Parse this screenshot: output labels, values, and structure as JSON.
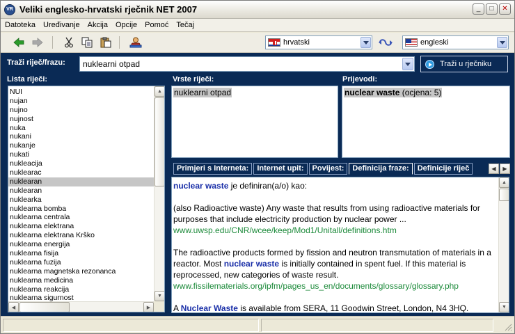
{
  "window": {
    "title": "Veliki englesko-hrvatski rječnik NET 2007",
    "app_icon_text": "VR",
    "controls": {
      "minimize": "_",
      "maximize": "□",
      "close": "✕"
    }
  },
  "menu": [
    "Datoteka",
    "Uređivanje",
    "Akcija",
    "Opcije",
    "Pomoć",
    "Tečaj"
  ],
  "toolbar": {
    "source_language": "hrvatski",
    "target_language": "engleski",
    "icons": [
      "back-arrow-icon",
      "forward-arrow-icon",
      "cut-icon",
      "copy-icon",
      "paste-icon",
      "user-icon",
      "swap-languages-icon"
    ]
  },
  "search": {
    "label": "Traži riječ/frazu:",
    "value": "nuklearni otpad",
    "button": "Traži u rječniku"
  },
  "word_list": {
    "label": "Lista riječi:",
    "items": [
      "NUI",
      "nujan",
      "nujno",
      "nujnost",
      "nuka",
      "nukani",
      "nukanje",
      "nukati",
      "nukleacija",
      "nuklearac",
      "nuklearan",
      "nuklearan",
      "nuklearka",
      "nuklearna bomba",
      "nuklearna centrala",
      "nuklearna elektrana",
      "nuklearna elektrana Krško",
      "nuklearna energija",
      "nuklearna fisija",
      "nuklearna fuzija",
      "nuklearna magnetska rezonanca",
      "nuklearna medicina",
      "nuklearna reakcija",
      "nuklearna sigurnost"
    ],
    "selected_index": 10
  },
  "word_types": {
    "label": "Vrste riječi:",
    "items": [
      "nuklearni otpad"
    ]
  },
  "translations": {
    "label": "Prijevodi:",
    "term": "nuclear waste",
    "rating": "(ocjena: 5)"
  },
  "tabs": [
    "Primjeri s Interneta:",
    "Internet upit:",
    "Povijest:",
    "Definicija fraze:",
    "Definicije riječ"
  ],
  "active_tab": 3,
  "definition": {
    "intro_term": "nuclear waste",
    "intro_rest": " je definiran(a/o) kao:",
    "p1_text": "(also Radioactive waste) Any waste that results from using radioactive materials for purposes that include electricity production by nuclear power ...",
    "p1_link": "www.uwsp.edu/CNR/wcee/keep/Mod1/Unitall/definitions.htm",
    "p2_before": "The radioactive products formed by fission and neutron transmutation of materials in a reactor. Most ",
    "p2_term": "nuclear waste",
    "p2_after": " is initially contained in spent fuel. If this material is reprocessed, new categories of waste result.",
    "p2_link": "www.fissilematerials.org/ipfm/pages_us_en/documents/glossary/glossary.php",
    "p3_before": "A ",
    "p3_term": "Nuclear Waste",
    "p3_after": " is available from SERA, 11 Goodwin Street, London, N4 3HQ."
  },
  "colors": {
    "pane_background": "#0a2a55",
    "term_color": "#1a2fa8",
    "link_color": "#1c8a3a",
    "selection": "#c6c6c6"
  }
}
